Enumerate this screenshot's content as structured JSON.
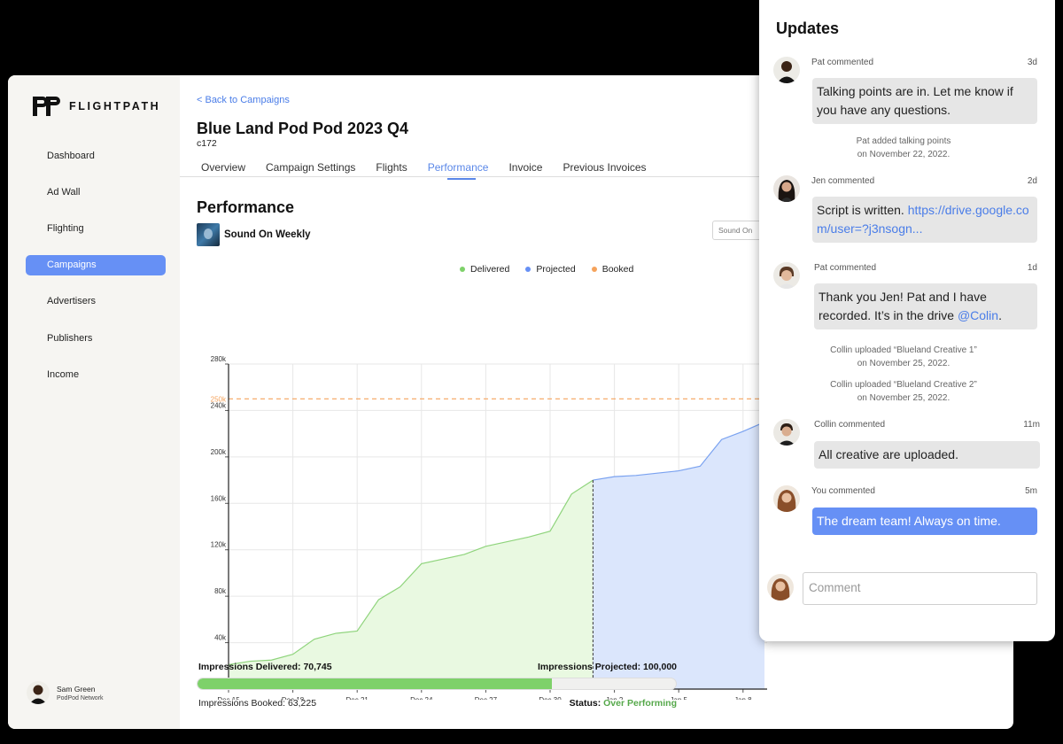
{
  "app": {
    "brand": "FLIGHTPATH",
    "accent_color": "#6690f5"
  },
  "sidebar": {
    "items": [
      {
        "label": "Dashboard"
      },
      {
        "label": "Ad Wall"
      },
      {
        "label": "Flighting"
      },
      {
        "label": "Campaigns",
        "active": true
      },
      {
        "label": "Advertisers"
      },
      {
        "label": "Publishers"
      },
      {
        "label": "Income"
      }
    ],
    "user": {
      "name": "Sam Green",
      "org": "PodPod Network"
    }
  },
  "header": {
    "back_link": "< Back to Campaigns",
    "title": "Blue Land Pod Pod 2023 Q4",
    "code": "c172"
  },
  "tabs": [
    {
      "label": "Overview"
    },
    {
      "label": "Campaign Settings"
    },
    {
      "label": "Flights"
    },
    {
      "label": "Performance",
      "active": true
    },
    {
      "label": "Invoice"
    },
    {
      "label": "Previous Invoices"
    }
  ],
  "performance": {
    "section_title": "Performance",
    "show_name": "Sound On Weekly",
    "select_value": "Sound On",
    "summary": {
      "delivered": "Impressions Delivered: 70,745",
      "projected": "Impressions Projected: 100,000",
      "booked": "Impressions Booked: 63,225",
      "status_label": "Status:",
      "status_value": "Over Performing",
      "progress_fraction": 0.74
    }
  },
  "chart_data": {
    "type": "area",
    "legend": [
      {
        "name": "Delivered",
        "color": "#7ed16a"
      },
      {
        "name": "Projected",
        "color": "#6690f5"
      },
      {
        "name": "Booked",
        "color": "#f5a35c"
      }
    ],
    "legend_position": "top",
    "x_ticks": [
      "Dec 15",
      "Dec 18",
      "Dec 21",
      "Dec 24",
      "Dec 27",
      "Dec 30",
      "Jan 2",
      "Jan 5",
      "Jan 8"
    ],
    "y_ticks": [
      "280k",
      "240k",
      "200k",
      "160k",
      "120k",
      "80k",
      "40k"
    ],
    "ylim": [
      0,
      280000
    ],
    "booked_line": {
      "value": 250000,
      "label": "250k"
    },
    "x_start": "Dec 15",
    "grid": true,
    "series": [
      {
        "name": "Delivered",
        "points": [
          [
            "Dec 15",
            21000
          ],
          [
            "Dec 16",
            24000
          ],
          [
            "Dec 17",
            25000
          ],
          [
            "Dec 18",
            30000
          ],
          [
            "Dec 19",
            43000
          ],
          [
            "Dec 20",
            48000
          ],
          [
            "Dec 21",
            50000
          ],
          [
            "Dec 22",
            77000
          ],
          [
            "Dec 23",
            88000
          ],
          [
            "Dec 24",
            108000
          ],
          [
            "Dec 25",
            112000
          ],
          [
            "Dec 26",
            116000
          ],
          [
            "Dec 27",
            123000
          ],
          [
            "Dec 28",
            127000
          ],
          [
            "Dec 29",
            131000
          ],
          [
            "Dec 30",
            136000
          ],
          [
            "Dec 31",
            168000
          ],
          [
            "Jan 1",
            180000
          ]
        ]
      },
      {
        "name": "Projected",
        "points": [
          [
            "Jan 1",
            180000
          ],
          [
            "Jan 2",
            183000
          ],
          [
            "Jan 3",
            184000
          ],
          [
            "Jan 4",
            186000
          ],
          [
            "Jan 5",
            188000
          ],
          [
            "Jan 6",
            192000
          ],
          [
            "Jan 7",
            215000
          ],
          [
            "Jan 8",
            222000
          ],
          [
            "Jan 9",
            230000
          ]
        ]
      }
    ]
  },
  "updates": {
    "title": "Updates",
    "comment_placeholder": "Comment",
    "entries": [
      {
        "author": "Pat commented",
        "time": "3d",
        "text": "Talking points are in. Let me know if you have any questions."
      },
      {
        "note_1": "Pat added talking points",
        "note_2": "on November 22, 2022."
      },
      {
        "author": "Jen commented",
        "time": "2d",
        "text": "Script is written. ",
        "link": "https://drive.google.com/user=?j3nsogn..."
      },
      {
        "author": "Pat commented",
        "time": "1d",
        "text": "Thank you Jen! Pat and I have recorded. It’s in the drive ",
        "mention": "@Colin",
        "suffix": "."
      },
      {
        "note_1": "Collin uploaded “Blueland Creative 1”",
        "note_2": "on November 25, 2022."
      },
      {
        "note_1": "Collin uploaded “Blueland Creative 2”",
        "note_2": "on November 25, 2022."
      },
      {
        "author": "Collin commented",
        "time": "11m",
        "text": "All creative are uploaded."
      },
      {
        "author": "You commented",
        "time": "5m",
        "text": "The dream team! Always on time."
      }
    ]
  }
}
